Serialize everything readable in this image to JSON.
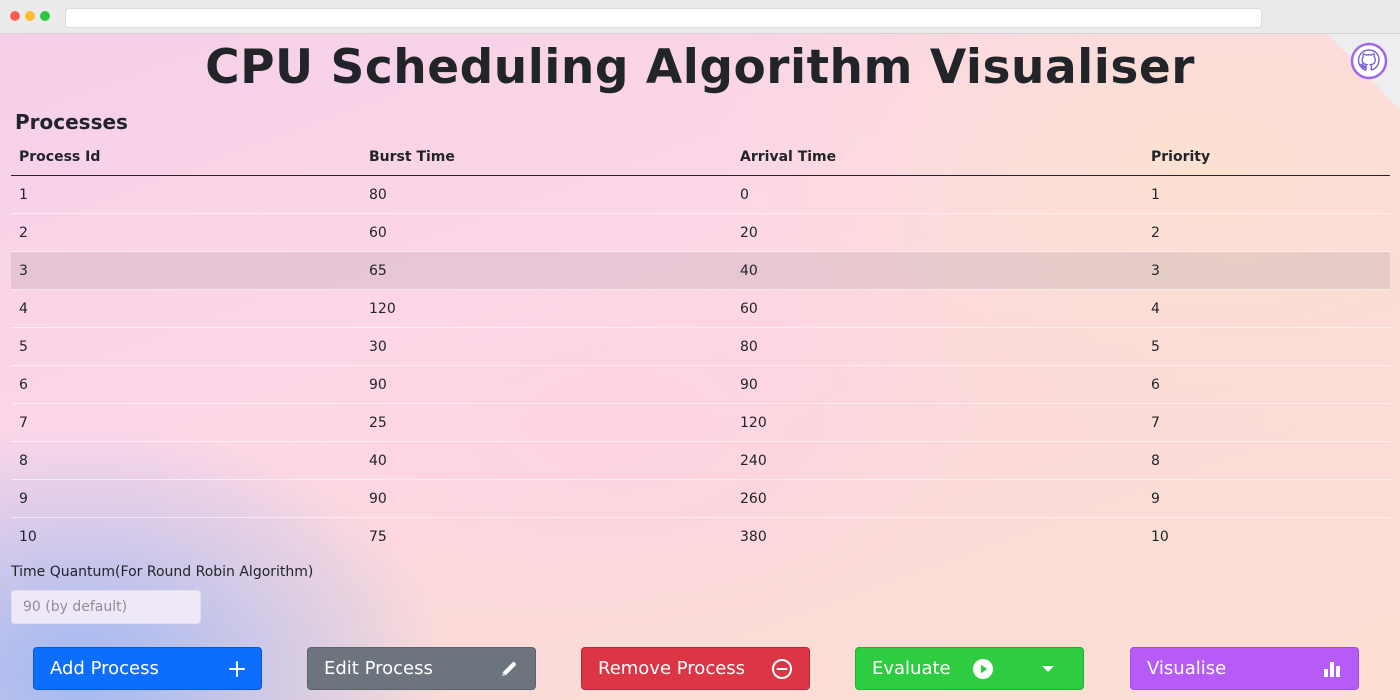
{
  "browser": {
    "window_controls": [
      "close",
      "minimize",
      "maximize"
    ]
  },
  "page": {
    "title": "CPU Scheduling Algorithm Visualiser",
    "github_corner_icon": "github-icon"
  },
  "processes": {
    "heading": "Processes",
    "columns": [
      "Process Id",
      "Burst Time",
      "Arrival Time",
      "Priority"
    ],
    "rows": [
      [
        "1",
        "80",
        "0",
        "1"
      ],
      [
        "2",
        "60",
        "20",
        "2"
      ],
      [
        "3",
        "65",
        "40",
        "3"
      ],
      [
        "4",
        "120",
        "60",
        "4"
      ],
      [
        "5",
        "30",
        "80",
        "5"
      ],
      [
        "6",
        "90",
        "90",
        "6"
      ],
      [
        "7",
        "25",
        "120",
        "7"
      ],
      [
        "8",
        "40",
        "240",
        "8"
      ],
      [
        "9",
        "90",
        "260",
        "9"
      ],
      [
        "10",
        "75",
        "380",
        "10"
      ]
    ],
    "highlighted_row": 3
  },
  "time_quantum": {
    "label": "Time Quantum(For Round Robin Algorithm)",
    "value": "",
    "placeholder": "90 (by default)"
  },
  "actions": {
    "add": {
      "label": "Add Process",
      "icon": "plus-icon",
      "color": "#0d6efd"
    },
    "edit": {
      "label": "Edit Process",
      "icon": "pencil-icon",
      "color": "#6c757d"
    },
    "remove": {
      "label": "Remove Process",
      "icon": "minus-circle-icon",
      "color": "#dc3545"
    },
    "evaluate": {
      "label": "Evaluate",
      "icon": "play-circle-icon",
      "dropdown_icon": "caret-down-icon",
      "color": "#2ecc40"
    },
    "visualise": {
      "label": "Visualise",
      "icon": "bar-chart-icon",
      "color": "#b65bf6"
    }
  }
}
